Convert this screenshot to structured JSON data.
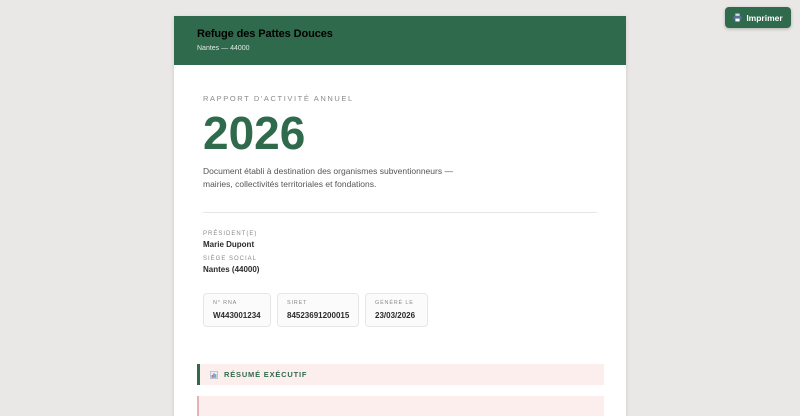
{
  "toolbar": {
    "print_label": "Imprimer"
  },
  "header": {
    "org_name": "Refuge des Pattes Douces",
    "location": "Nantes — 44000"
  },
  "cover": {
    "kicker": "RAPPORT D'ACTIVITÉ ANNUEL",
    "year": "2026",
    "intro_line1": "Document établi à destination des organismes subventionneurs —",
    "intro_line2": "mairies, collectivités territoriales et fondations."
  },
  "meta": {
    "president_label": "PRÉSIDENT(E)",
    "president_value": "Marie Dupont",
    "seat_label": "SIÈGE SOCIAL",
    "seat_value": "Nantes (44000)"
  },
  "ids": [
    {
      "label": "N° RNA",
      "value": "W443001234"
    },
    {
      "label": "SIRET",
      "value": "84523691200015"
    },
    {
      "label": "GÉNÉRÉ LE",
      "value": "23/03/2026"
    }
  ],
  "sections": {
    "summary_title": "RÉSUMÉ EXÉCUTIF"
  },
  "colors": {
    "accent": "#2f6a4c",
    "section_bg": "#fdeeee",
    "page_bg": "#e9e8e6"
  },
  "icons": {
    "print": "printer-icon",
    "summary": "bar-chart-icon"
  }
}
